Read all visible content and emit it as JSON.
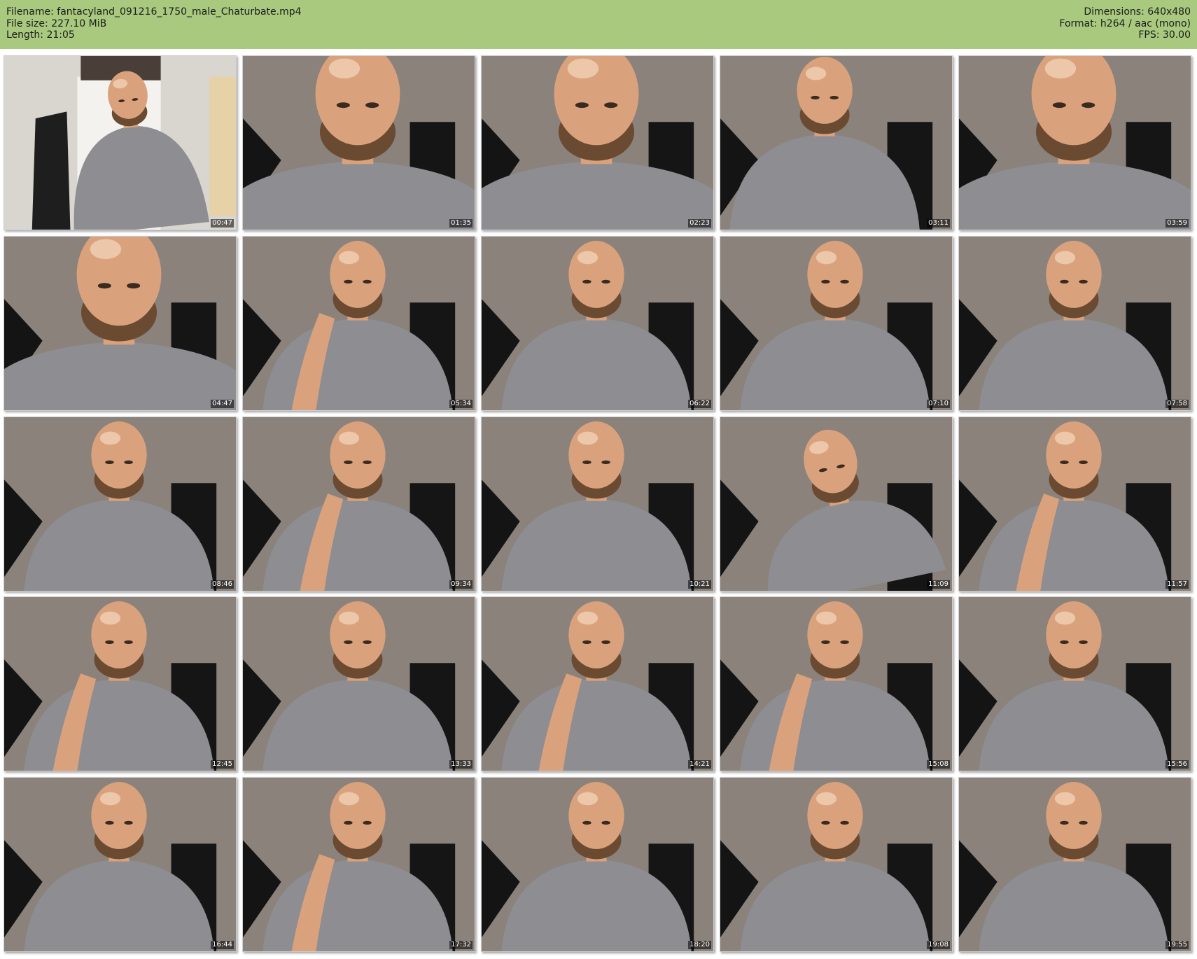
{
  "meta": {
    "filename": "Filename: fantacyland_091216_1750_male_Chaturbate.mp4",
    "filesize": "File size: 227.10 MiB",
    "length": "Length: 21:05",
    "dimensions": "Dimensions: 640x480",
    "format": "Format: h264 / aac (mono)",
    "fps": "FPS: 30.00"
  },
  "colors": {
    "header_bg": "#a9c97f",
    "wall": "#8a827b",
    "shirt": "#8d8d92",
    "skin": "#d9a27c",
    "beard": "#6b4a32"
  },
  "thumbnails": [
    {
      "timestamp": "00:47",
      "scene": "room"
    },
    {
      "timestamp": "01:35",
      "scene": "closeup"
    },
    {
      "timestamp": "02:23",
      "scene": "closeup"
    },
    {
      "timestamp": "03:11",
      "scene": "lean"
    },
    {
      "timestamp": "03:59",
      "scene": "closeup"
    },
    {
      "timestamp": "04:47",
      "scene": "closeup"
    },
    {
      "timestamp": "05:34",
      "scene": "hand"
    },
    {
      "timestamp": "06:22",
      "scene": "seated"
    },
    {
      "timestamp": "07:10",
      "scene": "seated"
    },
    {
      "timestamp": "07:58",
      "scene": "seated"
    },
    {
      "timestamp": "08:46",
      "scene": "seated"
    },
    {
      "timestamp": "09:34",
      "scene": "hand"
    },
    {
      "timestamp": "10:21",
      "scene": "seated"
    },
    {
      "timestamp": "11:09",
      "scene": "tilt"
    },
    {
      "timestamp": "11:57",
      "scene": "hand"
    },
    {
      "timestamp": "12:45",
      "scene": "hand"
    },
    {
      "timestamp": "13:33",
      "scene": "seated"
    },
    {
      "timestamp": "14:21",
      "scene": "hand"
    },
    {
      "timestamp": "15:08",
      "scene": "hand"
    },
    {
      "timestamp": "15:56",
      "scene": "seated"
    },
    {
      "timestamp": "16:44",
      "scene": "seated"
    },
    {
      "timestamp": "17:32",
      "scene": "hand"
    },
    {
      "timestamp": "18:20",
      "scene": "seated"
    },
    {
      "timestamp": "19:08",
      "scene": "seated"
    },
    {
      "timestamp": "19:55",
      "scene": "seated"
    }
  ]
}
